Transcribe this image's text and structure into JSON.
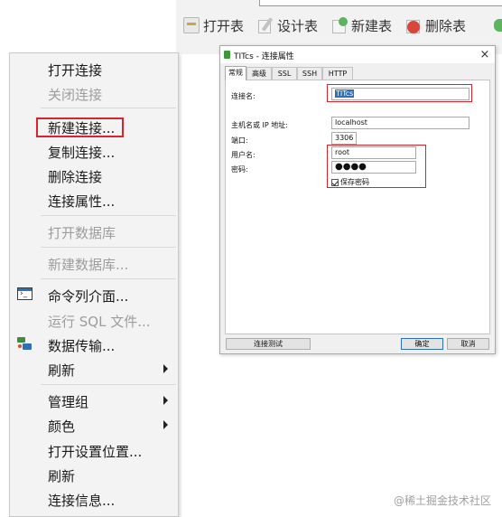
{
  "toolbar": {
    "buttons": [
      {
        "label": "打开表",
        "icon": "open-table-icon"
      },
      {
        "label": "设计表",
        "icon": "design-table-icon"
      },
      {
        "label": "新建表",
        "icon": "new-table-icon"
      },
      {
        "label": "删除表",
        "icon": "delete-table-icon"
      }
    ]
  },
  "menu": {
    "items": [
      {
        "label": "打开连接",
        "enabled": true
      },
      {
        "label": "关闭连接",
        "enabled": false
      },
      {
        "label": "新建连接...",
        "enabled": true,
        "highlighted": true
      },
      {
        "label": "复制连接...",
        "enabled": true
      },
      {
        "label": "删除连接",
        "enabled": true
      },
      {
        "label": "连接属性...",
        "enabled": true
      },
      {
        "label": "打开数据库",
        "enabled": false
      },
      {
        "label": "新建数据库...",
        "enabled": false
      },
      {
        "label": "命令列介面...",
        "enabled": true,
        "icon": "command-line-icon"
      },
      {
        "label": "运行 SQL 文件...",
        "enabled": false
      },
      {
        "label": "数据传输...",
        "enabled": true,
        "icon": "data-transfer-icon"
      },
      {
        "label": "刷新",
        "enabled": true,
        "submenu": true
      },
      {
        "label": "管理组",
        "enabled": true,
        "submenu": true
      },
      {
        "label": "颜色",
        "enabled": true,
        "submenu": true
      },
      {
        "label": "打开设置位置...",
        "enabled": true
      },
      {
        "label": "刷新",
        "enabled": true
      },
      {
        "label": "连接信息...",
        "enabled": true
      }
    ]
  },
  "dialog": {
    "title": "TITcs - 连接属性",
    "close": "×",
    "tabs": [
      "常规",
      "高级",
      "SSL",
      "SSH",
      "HTTP"
    ],
    "active_tab": "常规",
    "fields": {
      "connection_name_label": "连接名:",
      "connection_name_value": "TITcs",
      "host_label": "主机名或 IP 地址:",
      "host_value": "localhost",
      "port_label": "端口:",
      "port_value": "3306",
      "user_label": "用户名:",
      "user_value": "root",
      "password_label": "密码:",
      "password_value": "●●●●",
      "save_password_label": "保存密码",
      "save_password_checked": true
    },
    "buttons": {
      "test": "连接测试",
      "ok": "确定",
      "cancel": "取消"
    }
  },
  "watermark": "@稀土掘金技术社区",
  "colors": {
    "highlight_red": "#d9232d",
    "selection_blue": "#2f6fb4",
    "disabled_text": "#9d9d9d"
  }
}
